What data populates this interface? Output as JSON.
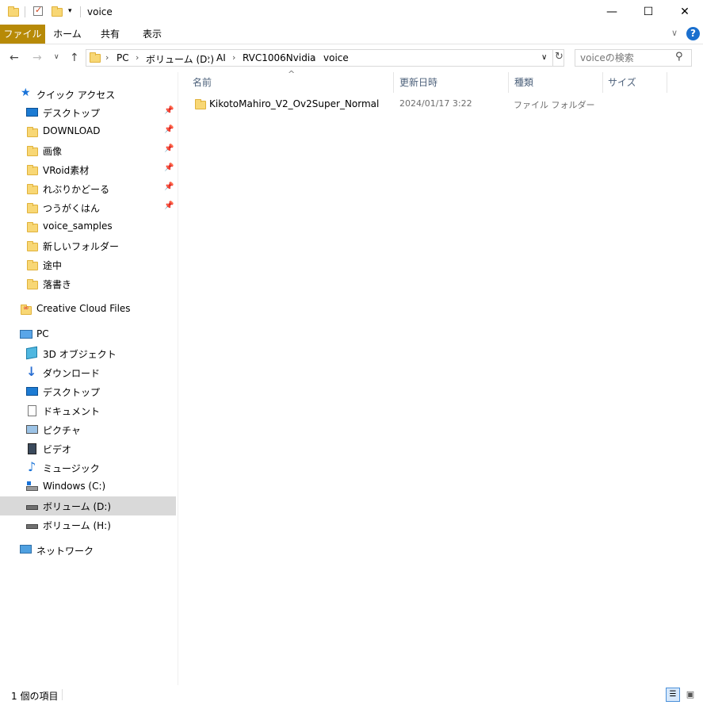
{
  "window": {
    "title": "voice",
    "controls": {
      "minimize": "—",
      "maximize": "☐",
      "close": "✕"
    }
  },
  "ribbon": {
    "tabs": [
      "ファイル",
      "ホーム",
      "共有",
      "表示"
    ],
    "collapse_glyph": "∨",
    "help_glyph": "?"
  },
  "address": {
    "breadcrumbs": [
      "PC",
      "ボリューム (D:)",
      "AI",
      "RVC1006Nvidia",
      "voice"
    ],
    "search_placeholder": "voiceの検索"
  },
  "sidebar": {
    "quick_access": {
      "label": "クイック アクセス",
      "items": [
        {
          "label": "デスクトップ",
          "icon": "desktop-icon",
          "pinned": true
        },
        {
          "label": "DOWNLOAD",
          "icon": "folder-icon",
          "pinned": true
        },
        {
          "label": "画像",
          "icon": "folder-icon",
          "pinned": true
        },
        {
          "label": "VRoid素材",
          "icon": "folder-icon",
          "pinned": true
        },
        {
          "label": "れぶりかどーる",
          "icon": "folder-icon",
          "pinned": true
        },
        {
          "label": "つうがくはん",
          "icon": "folder-icon",
          "pinned": true
        },
        {
          "label": "voice_samples",
          "icon": "folder-icon",
          "pinned": false
        },
        {
          "label": "新しいフォルダー",
          "icon": "folder-icon",
          "pinned": false
        },
        {
          "label": "途中",
          "icon": "folder-icon",
          "pinned": false
        },
        {
          "label": "落書き",
          "icon": "folder-icon",
          "pinned": false
        }
      ]
    },
    "creative_cloud": {
      "label": "Creative Cloud Files"
    },
    "pc": {
      "label": "PC",
      "items": [
        {
          "label": "3D オブジェクト",
          "icon": "3d-objects-icon"
        },
        {
          "label": "ダウンロード",
          "icon": "download-icon"
        },
        {
          "label": "デスクトップ",
          "icon": "desktop-icon"
        },
        {
          "label": "ドキュメント",
          "icon": "documents-icon"
        },
        {
          "label": "ピクチャ",
          "icon": "pictures-icon"
        },
        {
          "label": "ビデオ",
          "icon": "videos-icon"
        },
        {
          "label": "ミュージック",
          "icon": "music-icon"
        },
        {
          "label": "Windows (C:)",
          "icon": "drive-c-icon"
        },
        {
          "label": "ボリューム (D:)",
          "icon": "drive-icon",
          "selected": true
        },
        {
          "label": "ボリューム (H:)",
          "icon": "drive-icon"
        }
      ]
    },
    "network": {
      "label": "ネットワーク"
    }
  },
  "file_list": {
    "columns": [
      "名前",
      "更新日時",
      "種類",
      "サイズ"
    ],
    "sort_glyph": "^",
    "rows": [
      {
        "name": "KikotoMahiro_V2_Ov2Super_Normal",
        "modified": "2024/01/17 3:22",
        "type": "ファイル フォルダー",
        "size": ""
      }
    ]
  },
  "status": {
    "item_count": "1 個の項目"
  },
  "colors": {
    "file_tab": "#b78a07",
    "selection": "#d9d9d9",
    "folder": "#f8d775",
    "header_text": "#4c607a"
  }
}
